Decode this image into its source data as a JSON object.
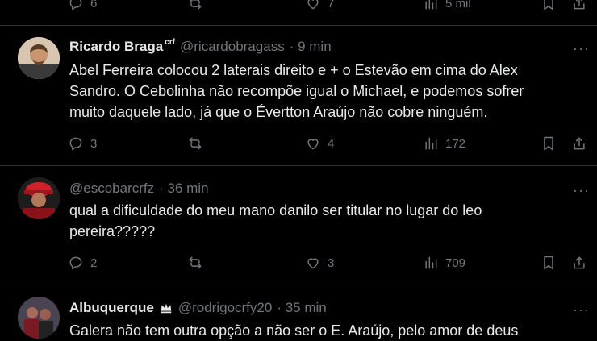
{
  "top_stats": {
    "replies": "6",
    "likes": "7",
    "views": "5 mil"
  },
  "tweets": [
    {
      "name": "Ricardo Braga",
      "badge": "crf",
      "handle": "@ricardobragass",
      "time": "· 9 min",
      "text_lines": [
        "Abel Ferreira colocou 2 laterais direito e + o Estevão em cima do Alex",
        "Sandro. O Cebolinha não recompõe igual o Michael, e podemos sofrer",
        "muito daquele lado, já que o Évertton Araújo não cobre ninguém."
      ],
      "replies": "3",
      "likes": "4",
      "views": "172"
    },
    {
      "name": "",
      "handle": "@escobarcrfz",
      "time": "· 36 min",
      "text_lines": [
        "qual a dificuldade do meu mano danilo ser titular no lugar do leo",
        "pereira?????"
      ],
      "replies": "2",
      "likes": "3",
      "views": "709"
    },
    {
      "name": "Albuquerque",
      "badge_icon": "crown-icon",
      "handle": "@rodrigocrfy20",
      "time": "· 35 min",
      "text_lines": [
        "Galera não tem outra opção a não ser o E. Araújo, pelo amor de deus"
      ]
    }
  ],
  "colors": {
    "background": "#000000",
    "text": "#e7e9ea",
    "muted": "#71767b",
    "divider": "#2f3336"
  }
}
